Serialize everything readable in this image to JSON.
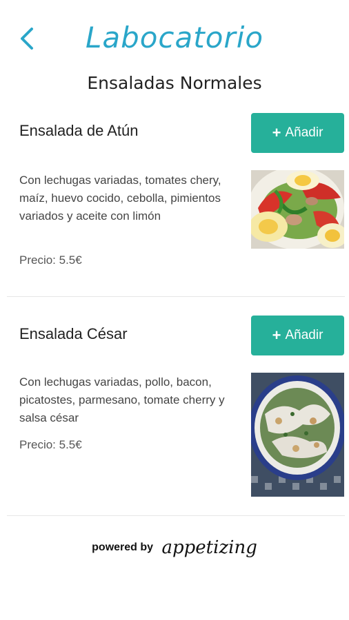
{
  "header": {
    "back_icon": "chevron-left-icon",
    "title": "Labocatorio",
    "subtitle": "Ensaladas Normales",
    "accent_color": "#2aa6c9"
  },
  "items": [
    {
      "name": "Ensalada de Atún",
      "add_label": "Añadir",
      "description": "Con lechugas variadas, tomates chery, maíz, huevo cocido, cebolla, pimientos variados y aceite con limón",
      "price": "Precio: 5.5€",
      "image": "tuna-salad-photo"
    },
    {
      "name": "Ensalada César",
      "add_label": "Añadir",
      "description": "Con lechugas variadas, pollo, bacon, picatostes, parmesano, tomate cherry y salsa césar",
      "price": "Precio: 5.5€",
      "image": "caesar-salad-photo"
    }
  ],
  "button_color": "#26b09a",
  "footer": {
    "powered_by": "powered by",
    "brand": "appetizing"
  }
}
